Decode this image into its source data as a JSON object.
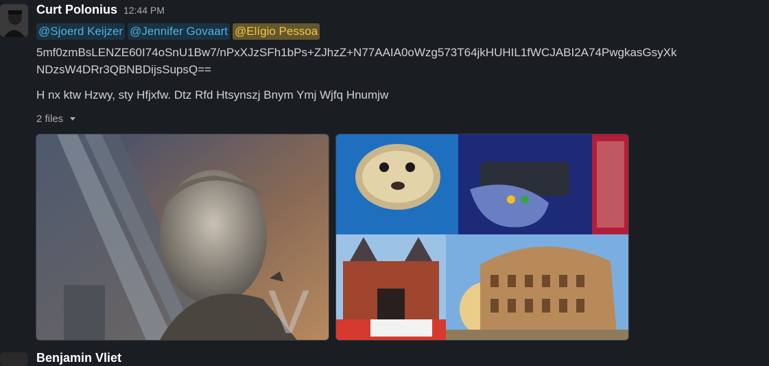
{
  "message": {
    "author": "Curt Polonius",
    "time": "12:44 PM",
    "mentions": [
      "@Sjoerd Keijzer",
      "@Jennifer Govaart",
      "@Elígio Pessoa"
    ],
    "lines": [
      "5mf0zmBsLENZE60I74oSnU1Bw7/nPxXJzSFh1bPs+ZJhzZ+N77AAIA0oWzg573T64jkHUHIL1fWCJABI2A74PwgkasGsyXk",
      "NDzsW4DRr3QBNBDijsSupsQ==",
      "H nx ktw Hzwy, sty Hfjxfw. Dtz Rfd Htsynszj Bnym Ymj Wjfq Hnumjw"
    ],
    "files_label": "2 files"
  },
  "images": {
    "left_overlay": "V"
  },
  "next_message": {
    "author": "Benjamin Vliet"
  },
  "colors": {
    "background": "#1a1d21",
    "mention_bg": "#1d9bd1",
    "self_mention_bg": "#f2c744"
  }
}
